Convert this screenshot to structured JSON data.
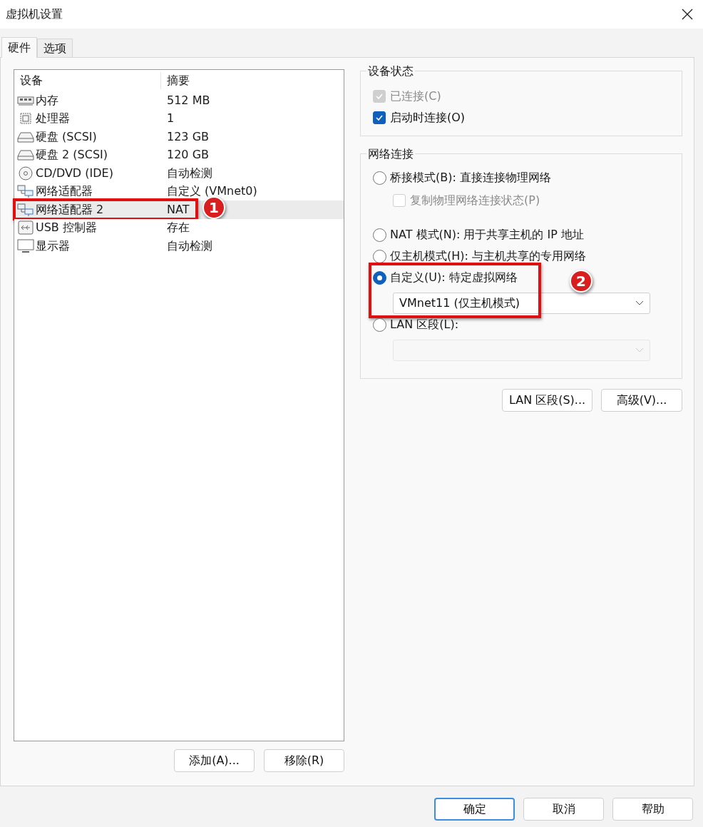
{
  "window": {
    "title": "虚拟机设置"
  },
  "tabs": [
    {
      "label": "硬件",
      "selected": true
    },
    {
      "label": "选项",
      "selected": false
    }
  ],
  "device_list": {
    "columns": [
      "设备",
      "摘要"
    ],
    "rows": [
      {
        "kind": "memory",
        "device": "内存",
        "summary": "512 MB",
        "selected": false
      },
      {
        "kind": "cpu",
        "device": "处理器",
        "summary": "1",
        "selected": false
      },
      {
        "kind": "disk",
        "device": "硬盘 (SCSI)",
        "summary": "123 GB",
        "selected": false
      },
      {
        "kind": "disk",
        "device": "硬盘 2 (SCSI)",
        "summary": "120 GB",
        "selected": false
      },
      {
        "kind": "cd",
        "device": "CD/DVD (IDE)",
        "summary": "自动检测",
        "selected": false
      },
      {
        "kind": "network",
        "device": "网络适配器",
        "summary": "自定义 (VMnet0)",
        "selected": false
      },
      {
        "kind": "network",
        "device": "网络适配器 2",
        "summary": "NAT",
        "selected": true,
        "annotation": "1"
      },
      {
        "kind": "usb",
        "device": "USB 控制器",
        "summary": "存在",
        "selected": false
      },
      {
        "kind": "display",
        "device": "显示器",
        "summary": "自动检测",
        "selected": false
      }
    ]
  },
  "list_buttons": [
    "添加(A)...",
    "移除(R)"
  ],
  "device_status": {
    "title": "设备状态",
    "checkboxes": [
      {
        "label": "已连接(C)",
        "checked": true,
        "disabled": true
      },
      {
        "label": "启动时连接(O)",
        "checked": true,
        "disabled": false
      }
    ]
  },
  "network_connection": {
    "title": "网络连接",
    "options": [
      {
        "label": "桥接模式(B): 直接连接物理网络",
        "selected": false,
        "sub_checkbox": {
          "label": "复制物理网络连接状态(P)",
          "checked": false,
          "disabled": true
        }
      },
      {
        "label": "NAT 模式(N): 用于共享主机的 IP 地址",
        "selected": false
      },
      {
        "label": "仅主机模式(H): 与主机共享的专用网络",
        "selected": false
      },
      {
        "label": "自定义(U): 特定虚拟网络",
        "selected": true,
        "dropdown": {
          "value": "VMnet11 (仅主机模式)",
          "disabled": false
        },
        "annotation": "2"
      },
      {
        "label": "LAN 区段(L):",
        "selected": false,
        "dropdown": {
          "disabled": true
        }
      }
    ]
  },
  "right_buttons": [
    "LAN 区段(S)...",
    "高级(V)..."
  ],
  "dialog_buttons": [
    {
      "label": "确定",
      "default": true
    },
    {
      "label": "取消",
      "default": false
    },
    {
      "label": "帮助",
      "default": false
    }
  ]
}
